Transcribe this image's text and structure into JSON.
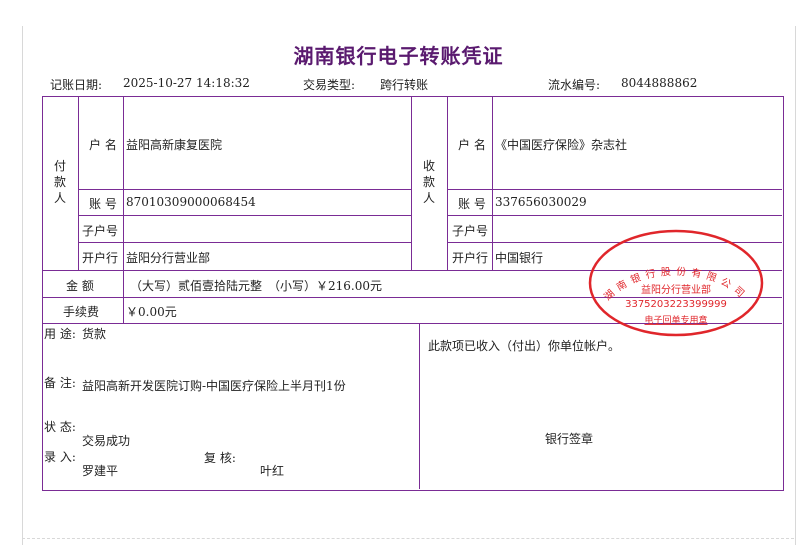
{
  "title": "湖南银行电子转账凭证",
  "meta": {
    "date_label": "记账日期:",
    "date_value": "2025-10-27 14:18:32",
    "type_label": "交易类型:",
    "type_value": "跨行转账",
    "serial_label": "流水编号:",
    "serial_value": "8044888862"
  },
  "payer": {
    "section_label": "付款人",
    "name_label": "户 名",
    "name_value": "益阳高新康复医院",
    "account_label": "账 号",
    "account_value": "87010309000068454",
    "sub_account_label": "子户号",
    "sub_account_value": "",
    "bank_label": "开户行",
    "bank_value": "益阳分行营业部"
  },
  "payee": {
    "section_label": "收款人",
    "name_label": "户 名",
    "name_value": "《中国医疗保险》杂志社",
    "account_label": "账 号",
    "account_value": "337656030029",
    "sub_account_label": "子户号",
    "sub_account_value": "",
    "bank_label": "开户行",
    "bank_value": "中国银行"
  },
  "amount": {
    "label": "金 额",
    "value": "（大写）贰佰壹拾陆元整　（小写）￥216.00元"
  },
  "fee": {
    "label": "手续费",
    "value": "￥0.00元"
  },
  "details": {
    "purpose_label": "用 途:",
    "purpose_value": "货款",
    "remark_label": "备 注:",
    "remark_value": "益阳高新开发医院订购-中国医疗保险上半月刊1份",
    "status_label": "状 态:",
    "status_value": "交易成功",
    "entry_label": "录 入:",
    "entry_value": "罗建平",
    "review_label": "复 核:",
    "review_value": "叶红"
  },
  "notice": "此款项已收入（付出）你单位帐户。",
  "bank_sign": "银行签章",
  "seal": {
    "arc_text": "湖南银行股份有限公司",
    "branch": "益阳分行营业部",
    "code": "3375203223399999",
    "purpose": "电子回单专用章",
    "color": "#e0262b"
  }
}
